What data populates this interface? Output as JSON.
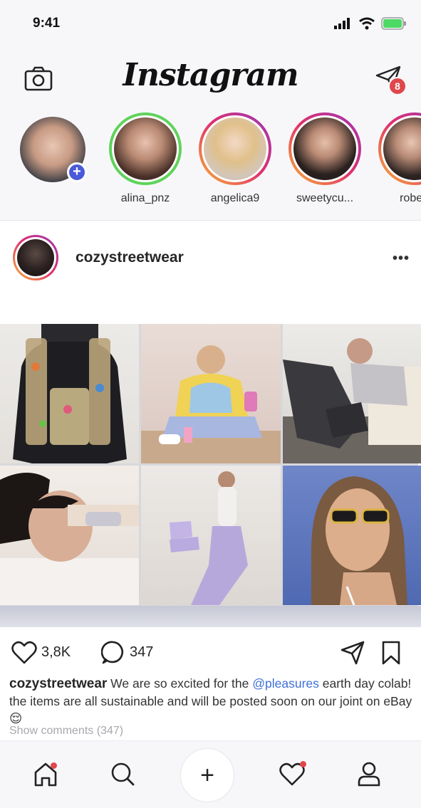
{
  "status_bar": {
    "time": "9:41",
    "icons": [
      "signal-icon",
      "wifi-icon",
      "battery-icon"
    ]
  },
  "header": {
    "logo": "Instagram",
    "camera_icon": "camera-icon",
    "direct_icon": "paper-plane-icon",
    "direct_badge": "8"
  },
  "stories": [
    {
      "name": "",
      "is_own": true
    },
    {
      "name": "alina_pnz",
      "ring": "green"
    },
    {
      "name": "angelica9",
      "ring": "gradient"
    },
    {
      "name": "sweetycu...",
      "ring": "gradient"
    },
    {
      "name": "robert",
      "ring": "gradient"
    }
  ],
  "post": {
    "username": "cozystreetwear",
    "more_label": "•••",
    "likes": "3,8K",
    "comments": "347",
    "caption": {
      "user": "cozystreetwear",
      "text_before": " We are so excited for the ",
      "mention": "@pleasures",
      "text_after": " earth day colab! the items are all sustainable and will be posted soon on our joint on eBay ",
      "emoji": "😌"
    },
    "show_comments": "Show comments  (347)"
  },
  "bottom_nav": {
    "add_label": "+",
    "items": [
      "home-icon",
      "search-icon",
      "add-icon",
      "heart-icon",
      "profile-icon"
    ]
  },
  "colors": {
    "accent_blue": "#3f6fd8",
    "badge_red": "#e0464b",
    "story_green": "#5fd35a"
  }
}
